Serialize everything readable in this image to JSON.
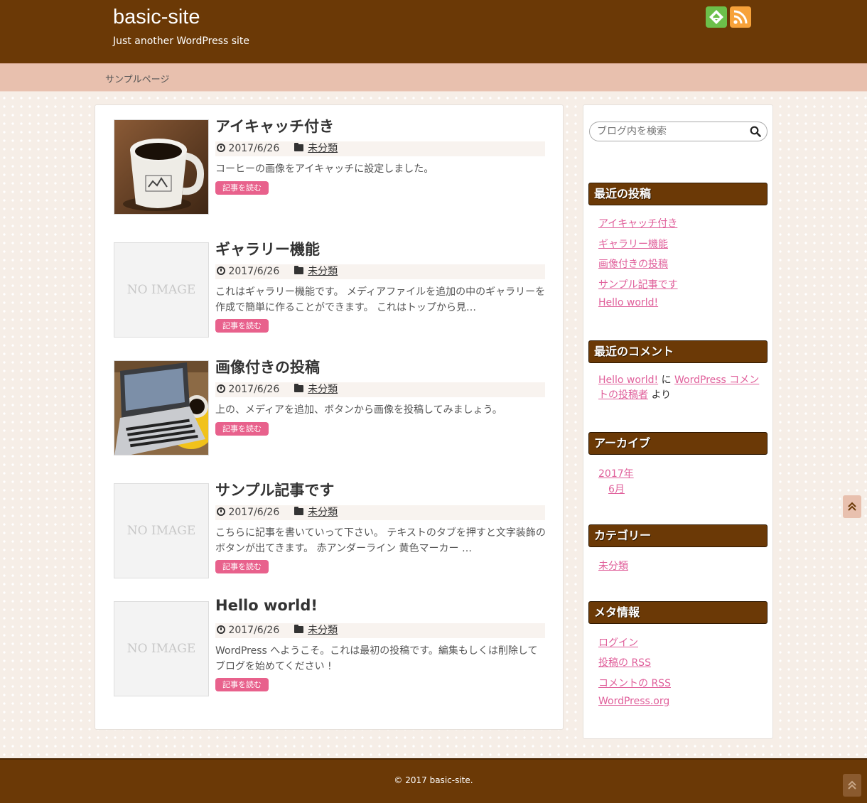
{
  "header": {
    "site_title": "basic-site",
    "site_description": "Just another WordPress site",
    "icons": [
      "feedly-icon",
      "rss-icon"
    ],
    "color": "#6b3906"
  },
  "nav": {
    "items": [
      {
        "label": "サンプルページ"
      }
    ],
    "color": "#e8c0ae"
  },
  "posts": [
    {
      "title": "アイキャッチ付き",
      "date": "2017/6/26",
      "category": "未分類",
      "excerpt": "コーヒーの画像をアイキャッチに設定しました。",
      "thumbnail": "coffee-mug-photo",
      "read_more": "記事を読む"
    },
    {
      "title": "ギャラリー機能",
      "date": "2017/6/26",
      "category": "未分類",
      "excerpt": "これはギャラリー機能です。 メディアファイルを追加の中のギャラリーを作成で簡単に作ることができます。 これはトップから見…",
      "thumbnail_text": "NO IMAGE",
      "read_more": "記事を読む"
    },
    {
      "title": "画像付きの投稿",
      "date": "2017/6/26",
      "category": "未分類",
      "excerpt": "上の、メディアを追加、ボタンから画像を投稿してみましょう。",
      "thumbnail": "laptop-photo",
      "read_more": "記事を読む"
    },
    {
      "title": "サンプル記事です",
      "date": "2017/6/26",
      "category": "未分類",
      "excerpt": "こちらに記事を書いていって下さい。 テキストのタブを押すと文字装飾のボタンが出てきます。 赤アンダーライン 黄色マーカー …",
      "thumbnail_text": "NO IMAGE",
      "read_more": "記事を読む"
    },
    {
      "title": "Hello world!",
      "date": "2017/6/26",
      "category": "未分類",
      "excerpt": "WordPress へようこそ。これは最初の投稿です。編集もしくは削除してブログを始めてください !",
      "thumbnail_text": "NO IMAGE",
      "read_more": "記事を読む"
    }
  ],
  "sidebar": {
    "search_placeholder": "ブログ内を検索",
    "recent_posts": {
      "title": "最近の投稿",
      "items": [
        "アイキャッチ付き",
        "ギャラリー機能",
        "画像付きの投稿",
        "サンプル記事です",
        "Hello world!"
      ]
    },
    "recent_comments": {
      "title": "最近のコメント",
      "post_link": "Hello world!",
      "connector_ni": "に",
      "author_link": "WordPress コメントの投稿者",
      "connector_yori": "より"
    },
    "archives": {
      "title": "アーカイブ",
      "year": "2017年",
      "month": "6月"
    },
    "categories": {
      "title": "カテゴリー",
      "items": [
        "未分類"
      ]
    },
    "meta": {
      "title": "メタ情報",
      "items": [
        "ログイン",
        "投稿の RSS",
        "コメントの RSS",
        "WordPress.org"
      ]
    }
  },
  "footer": {
    "copyright": "© 2017 basic-site."
  },
  "colors": {
    "accent_pink": "#e8618c",
    "link_pink": "#e0609b",
    "brown": "#6b3906"
  }
}
